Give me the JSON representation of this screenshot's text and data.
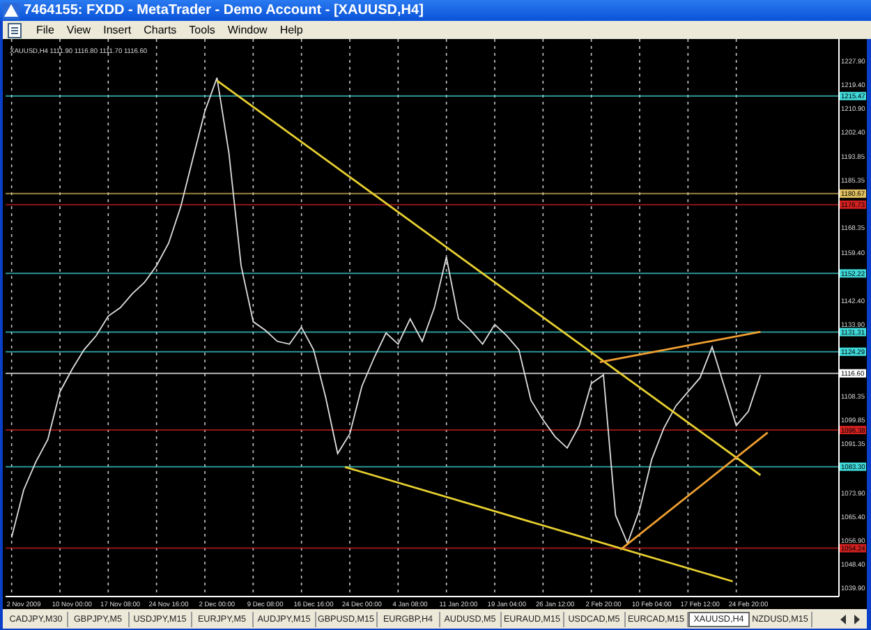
{
  "window": {
    "title": "7464155: FXDD - MetaTrader - Demo Account - [XAUUSD,H4]"
  },
  "menu": [
    "File",
    "View",
    "Insert",
    "Charts",
    "Tools",
    "Window",
    "Help"
  ],
  "chart": {
    "header": "XAUUSD,H4 1111.90 1116.80 1111.70 1116.60",
    "chart_data": {
      "type": "line",
      "grid": true,
      "ylim": [
        1037.0,
        1235.8
      ],
      "categories": [
        null,
        "2 Nov 2009",
        null,
        null,
        null,
        "10 Nov 00:00",
        null,
        null,
        null,
        "17 Nov 08:00",
        null,
        null,
        null,
        "24 Nov 16:00",
        null,
        null,
        null,
        "2 Dec 00:00",
        null,
        null,
        null,
        "9 Dec 08:00",
        null,
        null,
        null,
        "16 Dec 16:00",
        null,
        null,
        null,
        "24 Dec 00:00",
        null,
        null,
        null,
        "4 Jan 08:00",
        null,
        null,
        null,
        "11 Jan 20:00",
        null,
        null,
        null,
        "19 Jan 04:00",
        null,
        null,
        null,
        "26 Jan 12:00",
        null,
        null,
        null,
        "2 Feb 20:00",
        null,
        null,
        null,
        "10 Feb 04:00",
        null,
        null,
        null,
        "17 Feb 12:00",
        null,
        null,
        null,
        "24 Feb 20:00",
        null,
        null,
        null,
        null,
        null,
        null,
        null
      ],
      "series": [
        {
          "color": "#e0e0e0",
          "values": [
            1058,
            1075,
            1085,
            1093,
            1110,
            1118,
            1125,
            1130,
            1137,
            1140,
            1145,
            1149,
            1155,
            1163,
            1176,
            1193,
            1210,
            1222,
            1195,
            1155,
            1135,
            1132,
            1128,
            1127,
            1133,
            1125,
            1108,
            1088,
            1095,
            1112,
            1122,
            1131,
            1127,
            1136,
            1128,
            1140,
            1158,
            1136,
            1132,
            1127,
            1134,
            1130,
            1125,
            1107,
            1100,
            1094,
            1090,
            1098,
            1113,
            1116,
            1066,
            1056,
            1068,
            1086,
            1097,
            1105,
            1110,
            1115,
            1126,
            1112,
            1098,
            1103,
            1116,
            null,
            null,
            null,
            null,
            null,
            null
          ]
        }
      ],
      "yticks": [
        {
          "value": 1227.9,
          "label": "1227.90"
        },
        {
          "value": 1219.4,
          "label": "1219.40"
        },
        {
          "value": 1210.9,
          "label": "1210.90"
        },
        {
          "value": 1202.4,
          "label": "1202.40"
        },
        {
          "value": 1193.85,
          "label": "1193.85"
        },
        {
          "value": 1185.35,
          "label": "1185.35"
        },
        {
          "value": 1168.35,
          "label": "1168.35"
        },
        {
          "value": 1159.4,
          "label": "1159.40"
        },
        {
          "value": 1142.4,
          "label": "1142.40"
        },
        {
          "value": 1133.9,
          "label": "1133.90"
        },
        {
          "value": 1108.35,
          "label": "1108.35"
        },
        {
          "value": 1099.85,
          "label": "1099.85"
        },
        {
          "value": 1091.35,
          "label": "1091.35"
        },
        {
          "value": 1073.9,
          "label": "1073.90"
        },
        {
          "value": 1065.4,
          "label": "1065.40"
        },
        {
          "value": 1056.9,
          "label": "1056.90"
        },
        {
          "value": 1048.4,
          "label": "1048.40"
        },
        {
          "value": 1039.9,
          "label": "1039.90"
        }
      ],
      "ref_lines": [
        {
          "axis": "y",
          "value": 1215.47,
          "label": "1215.47",
          "color": "#40d8d8"
        },
        {
          "axis": "y",
          "value": 1180.67,
          "label": "1180.67",
          "color": "#e0c060"
        },
        {
          "axis": "y",
          "value": 1176.73,
          "label": "1176.73",
          "color": "#d02020"
        },
        {
          "axis": "y",
          "value": 1152.22,
          "label": "1152.22",
          "color": "#40d8d8"
        },
        {
          "axis": "y",
          "value": 1131.31,
          "label": "1131.31",
          "color": "#40d8d8"
        },
        {
          "axis": "y",
          "value": 1124.29,
          "label": "1124.29",
          "color": "#40d8d8"
        },
        {
          "axis": "y",
          "value": 1116.6,
          "label": "1116.60",
          "color": "#ffffff"
        },
        {
          "axis": "y",
          "value": 1096.38,
          "label": "1096.38",
          "color": "#d02020"
        },
        {
          "axis": "y",
          "value": 1083.3,
          "label": "1083.30",
          "color": "#40d8d8"
        },
        {
          "axis": "y",
          "value": 1054.24,
          "label": "1054.24",
          "color": "#d02020"
        }
      ]
    }
  },
  "tabs": [
    {
      "label": "CADJPY,M30",
      "selected": false
    },
    {
      "label": "GBPJPY,M5",
      "selected": false
    },
    {
      "label": "USDJPY,M15",
      "selected": false
    },
    {
      "label": "EURJPY,M5",
      "selected": false
    },
    {
      "label": "AUDJPY,M15",
      "selected": false
    },
    {
      "label": "GBPUSD,M15",
      "selected": false
    },
    {
      "label": "EURGBP,H4",
      "selected": false
    },
    {
      "label": "AUDUSD,M5",
      "selected": false
    },
    {
      "label": "EURAUD,M15",
      "selected": false
    },
    {
      "label": "USDCAD,M5",
      "selected": false
    },
    {
      "label": "EURCAD,M15",
      "selected": false
    },
    {
      "label": "XAUUSD,H4",
      "selected": true
    },
    {
      "label": "NZDUSD,M15",
      "selected": false
    }
  ]
}
